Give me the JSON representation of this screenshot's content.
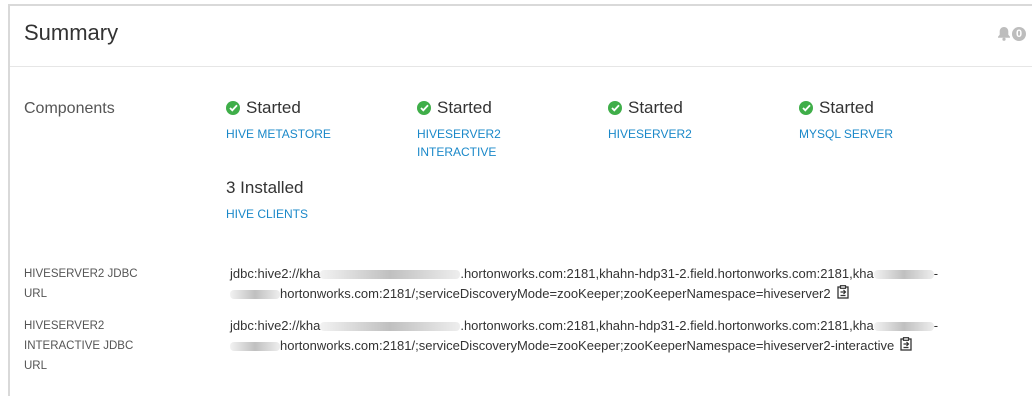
{
  "panel": {
    "title": "Summary",
    "alert_count": "0",
    "icons": {
      "alerts": "bell-icon",
      "status": "check-circle-icon",
      "copy": "clipboard-icon"
    },
    "colors": {
      "accent": "#1a88c9",
      "success": "#3fae49"
    }
  },
  "components": {
    "label": "Components",
    "items": [
      {
        "status": "Started",
        "name_line1": "HIVE METASTORE",
        "name_line2": ""
      },
      {
        "status": "Started",
        "name_line1": "HIVESERVER2",
        "name_line2": "INTERACTIVE"
      },
      {
        "status": "Started",
        "name_line1": "HIVESERVER2",
        "name_line2": ""
      },
      {
        "status": "Started",
        "name_line1": "MYSQL SERVER",
        "name_line2": ""
      }
    ],
    "installed": {
      "count_text": "3 Installed",
      "name": "HIVE CLIENTS"
    }
  },
  "jdbc": [
    {
      "label_line1": "HIVESERVER2 JDBC",
      "label_line2": "URL",
      "label_line3": "",
      "l1_a": "jdbc:hive2://kha",
      "l1_b": ".hortonworks.com:2181,khahn-hdp31-2.field.hortonworks.com:2181,kha",
      "l1_c": "-",
      "l2_a": "hortonworks.com:2181/;serviceDiscoveryMode=zooKeeper;zooKeeperNamespace=hiveserver2"
    },
    {
      "label_line1": "HIVESERVER2",
      "label_line2": "INTERACTIVE JDBC",
      "label_line3": "URL",
      "l1_a": "jdbc:hive2://kha",
      "l1_b": ".hortonworks.com:2181,khahn-hdp31-2.field.hortonworks.com:2181,kha",
      "l1_c": "-",
      "l2_a": "hortonworks.com:2181/;serviceDiscoveryMode=zooKeeper;zooKeeperNamespace=hiveserver2-interactive"
    }
  ]
}
